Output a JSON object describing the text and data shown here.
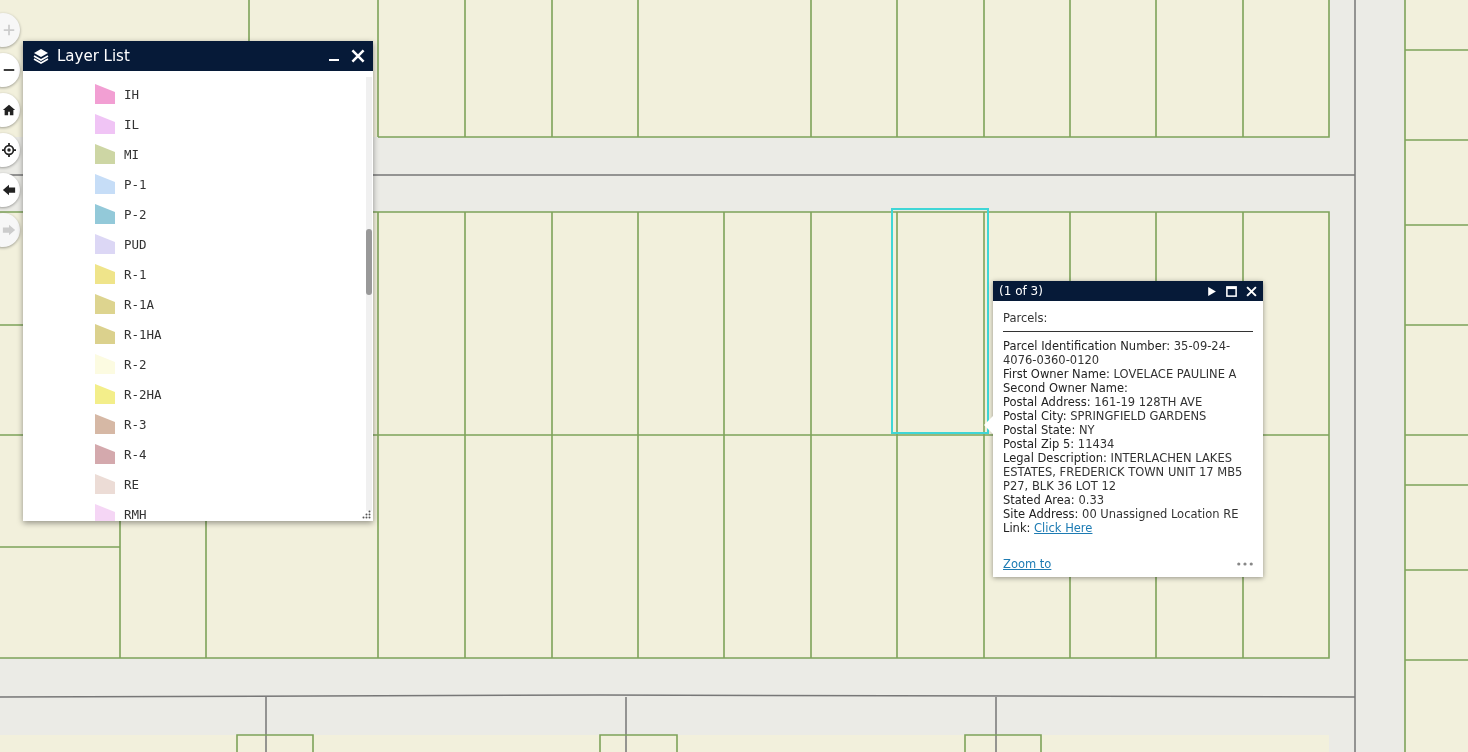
{
  "map_controls": [
    {
      "disabled": true
    },
    {
      "disabled": false
    },
    {
      "disabled": false
    },
    {
      "disabled": false
    },
    {
      "disabled": false
    },
    {
      "disabled": true
    }
  ],
  "layer_list": {
    "title": "Layer List",
    "items": [
      {
        "label": "IH",
        "color": "#f29fd3"
      },
      {
        "label": "IL",
        "color": "#f0c4f5"
      },
      {
        "label": "MI",
        "color": "#cdd6a4"
      },
      {
        "label": "P-1",
        "color": "#c6ddf7"
      },
      {
        "label": "P-2",
        "color": "#93c9d9"
      },
      {
        "label": "PUD",
        "color": "#dcd7f5"
      },
      {
        "label": "R-1",
        "color": "#efe48a"
      },
      {
        "label": "R-1A",
        "color": "#ddd48f"
      },
      {
        "label": "R-1HA",
        "color": "#dbd18d"
      },
      {
        "label": "R-2",
        "color": "#fcfbe1"
      },
      {
        "label": "R-2HA",
        "color": "#f3ee8a"
      },
      {
        "label": "R-3",
        "color": "#d6b8a5"
      },
      {
        "label": "R-4",
        "color": "#d4a9ad"
      },
      {
        "label": "RE",
        "color": "#ecdcd6"
      },
      {
        "label": "RMH",
        "color": "#f5d6f5"
      }
    ]
  },
  "popup": {
    "counter": "(1 of 3)",
    "layer": "Parcels:",
    "fields": [
      {
        "kind": "text",
        "text": "**Parcel Identification Number:** 35-09-24-4076-0360-0120"
      },
      {
        "kind": "text",
        "text": "**First Owner Name:** LOVELACE PAULINE A"
      },
      {
        "kind": "text",
        "text": "**Second Owner Name:**"
      },
      {
        "kind": "text",
        "text": "**Postal Address:** 161-19 128TH AVE"
      },
      {
        "kind": "text",
        "text": "**Postal City:** SPRINGFIELD GARDENS"
      },
      {
        "kind": "text",
        "text": "**Postal State:** NY"
      },
      {
        "kind": "text",
        "text": "**Postal Zip 5:** 11434"
      },
      {
        "kind": "text",
        "text": "**Legal Description:** INTERLACHEN LAKES ESTATES, FREDERICK TOWN UNIT 17 MB5 P27, BLK 36 LOT 12"
      },
      {
        "kind": "text",
        "text": "**Stated Area:** 0.33"
      },
      {
        "kind": "text",
        "text": "**Site Address:** 00 Unassigned Location RE"
      },
      {
        "kind": "link",
        "text": "**Link:**",
        "link": "Click Here"
      }
    ],
    "zoom_link": "Zoom to"
  }
}
